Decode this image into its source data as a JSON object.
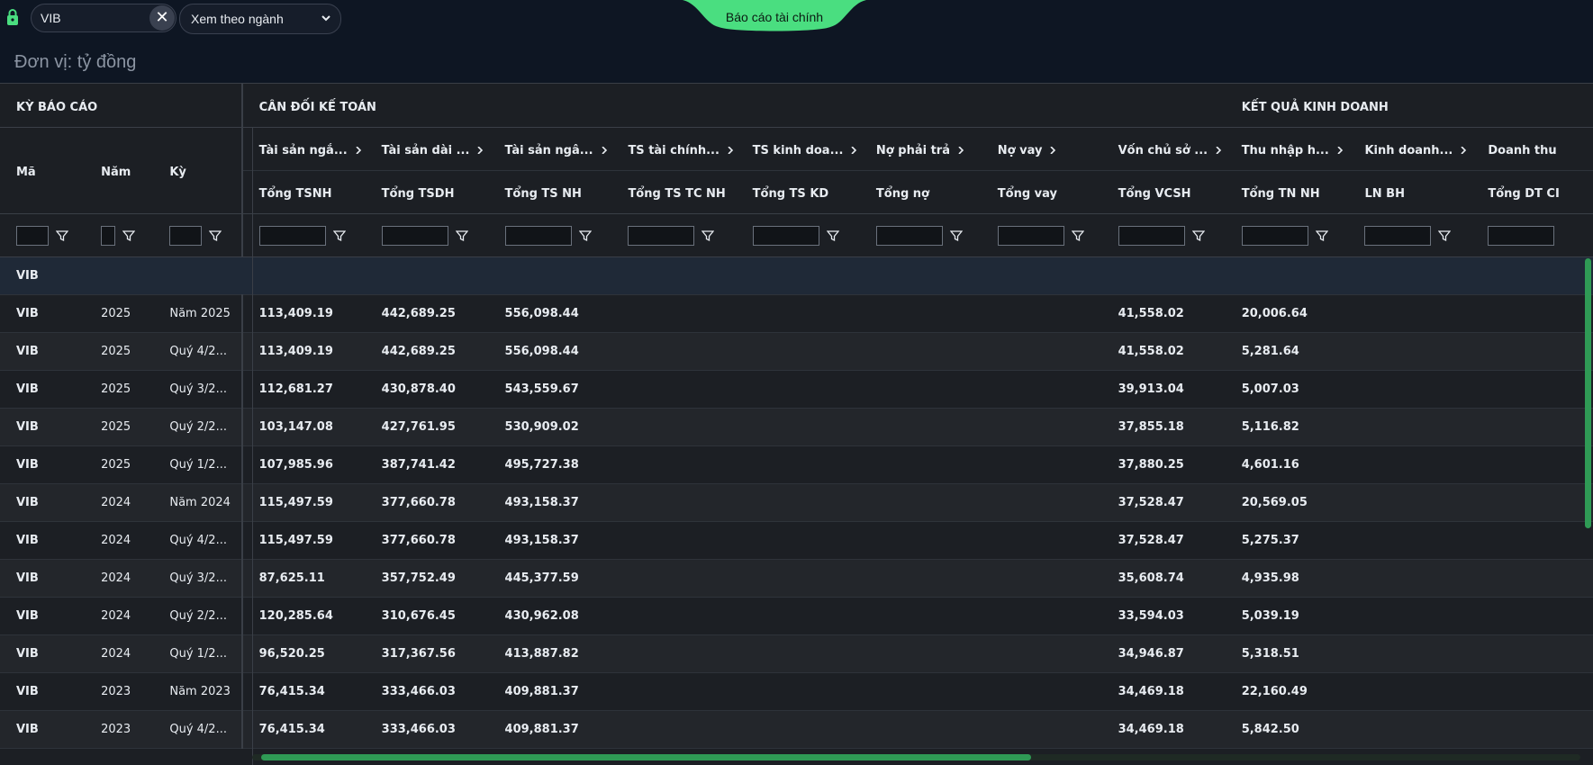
{
  "topbar": {
    "search_value": "VIB",
    "clear_label": "✕",
    "view_select_label": "Xem theo ngành",
    "active_tab": "Báo cáo tài chính"
  },
  "unit_label": "Đơn vị: tỷ đồng",
  "colors": {
    "accent": "#4ade80",
    "background": "#0e1623",
    "grid": "#1c1f24"
  },
  "table": {
    "groups": {
      "ky_bao_cao": "KỲ BÁO CÁO",
      "can_doi": "CÂN ĐỐI KẾ TOÁN",
      "ket_qua": "KẾT QUẢ KINH DOANH"
    },
    "fixed_headers": {
      "ma": "Mã",
      "nam": "Năm",
      "ky": "Kỳ"
    },
    "columns": [
      {
        "sub": "Tài sản ngắ...",
        "label": "Tổng TSNH"
      },
      {
        "sub": "Tài sản dài ...",
        "label": "Tổng TSDH"
      },
      {
        "sub": "Tài sản ngâ...",
        "label": "Tổng TS NH"
      },
      {
        "sub": "TS tài chính...",
        "label": "Tổng TS TC NH"
      },
      {
        "sub": "TS kinh doa...",
        "label": "Tổng TS KD"
      },
      {
        "sub": "Nợ phải trả",
        "label": "Tổng nợ"
      },
      {
        "sub": "Nợ vay",
        "label": "Tổng vay"
      },
      {
        "sub": "Vốn chủ sở ...",
        "label": "Tổng VCSH"
      },
      {
        "sub": "Thu nhập h...",
        "label": "Tổng TN NH"
      },
      {
        "sub": "Kinh doanh...",
        "label": "LN BH"
      },
      {
        "sub": "Doanh thu",
        "label": "Tổng DT CI"
      }
    ],
    "group_row_label": "VIB",
    "rows": [
      {
        "ma": "VIB",
        "nam": "2025",
        "ky": "Năm 2025",
        "tsnh": "113,409.19",
        "tsdh": "442,689.25",
        "tsnh2": "556,098.44",
        "vcsh": "41,558.02",
        "tnnh": "20,006.64"
      },
      {
        "ma": "VIB",
        "nam": "2025",
        "ky": "Quý 4/2...",
        "tsnh": "113,409.19",
        "tsdh": "442,689.25",
        "tsnh2": "556,098.44",
        "vcsh": "41,558.02",
        "tnnh": "5,281.64"
      },
      {
        "ma": "VIB",
        "nam": "2025",
        "ky": "Quý 3/2...",
        "tsnh": "112,681.27",
        "tsdh": "430,878.40",
        "tsnh2": "543,559.67",
        "vcsh": "39,913.04",
        "tnnh": "5,007.03"
      },
      {
        "ma": "VIB",
        "nam": "2025",
        "ky": "Quý 2/2...",
        "tsnh": "103,147.08",
        "tsdh": "427,761.95",
        "tsnh2": "530,909.02",
        "vcsh": "37,855.18",
        "tnnh": "5,116.82"
      },
      {
        "ma": "VIB",
        "nam": "2025",
        "ky": "Quý 1/2...",
        "tsnh": "107,985.96",
        "tsdh": "387,741.42",
        "tsnh2": "495,727.38",
        "vcsh": "37,880.25",
        "tnnh": "4,601.16"
      },
      {
        "ma": "VIB",
        "nam": "2024",
        "ky": "Năm 2024",
        "tsnh": "115,497.59",
        "tsdh": "377,660.78",
        "tsnh2": "493,158.37",
        "vcsh": "37,528.47",
        "tnnh": "20,569.05"
      },
      {
        "ma": "VIB",
        "nam": "2024",
        "ky": "Quý 4/2...",
        "tsnh": "115,497.59",
        "tsdh": "377,660.78",
        "tsnh2": "493,158.37",
        "vcsh": "37,528.47",
        "tnnh": "5,275.37"
      },
      {
        "ma": "VIB",
        "nam": "2024",
        "ky": "Quý 3/2...",
        "tsnh": "87,625.11",
        "tsdh": "357,752.49",
        "tsnh2": "445,377.59",
        "vcsh": "35,608.74",
        "tnnh": "4,935.98"
      },
      {
        "ma": "VIB",
        "nam": "2024",
        "ky": "Quý 2/2...",
        "tsnh": "120,285.64",
        "tsdh": "310,676.45",
        "tsnh2": "430,962.08",
        "vcsh": "33,594.03",
        "tnnh": "5,039.19"
      },
      {
        "ma": "VIB",
        "nam": "2024",
        "ky": "Quý 1/2...",
        "tsnh": "96,520.25",
        "tsdh": "317,367.56",
        "tsnh2": "413,887.82",
        "vcsh": "34,946.87",
        "tnnh": "5,318.51"
      },
      {
        "ma": "VIB",
        "nam": "2023",
        "ky": "Năm 2023",
        "tsnh": "76,415.34",
        "tsdh": "333,466.03",
        "tsnh2": "409,881.37",
        "vcsh": "34,469.18",
        "tnnh": "22,160.49"
      },
      {
        "ma": "VIB",
        "nam": "2023",
        "ky": "Quý 4/2...",
        "tsnh": "76,415.34",
        "tsdh": "333,466.03",
        "tsnh2": "409,881.37",
        "vcsh": "34,469.18",
        "tnnh": "5,842.50"
      }
    ]
  }
}
